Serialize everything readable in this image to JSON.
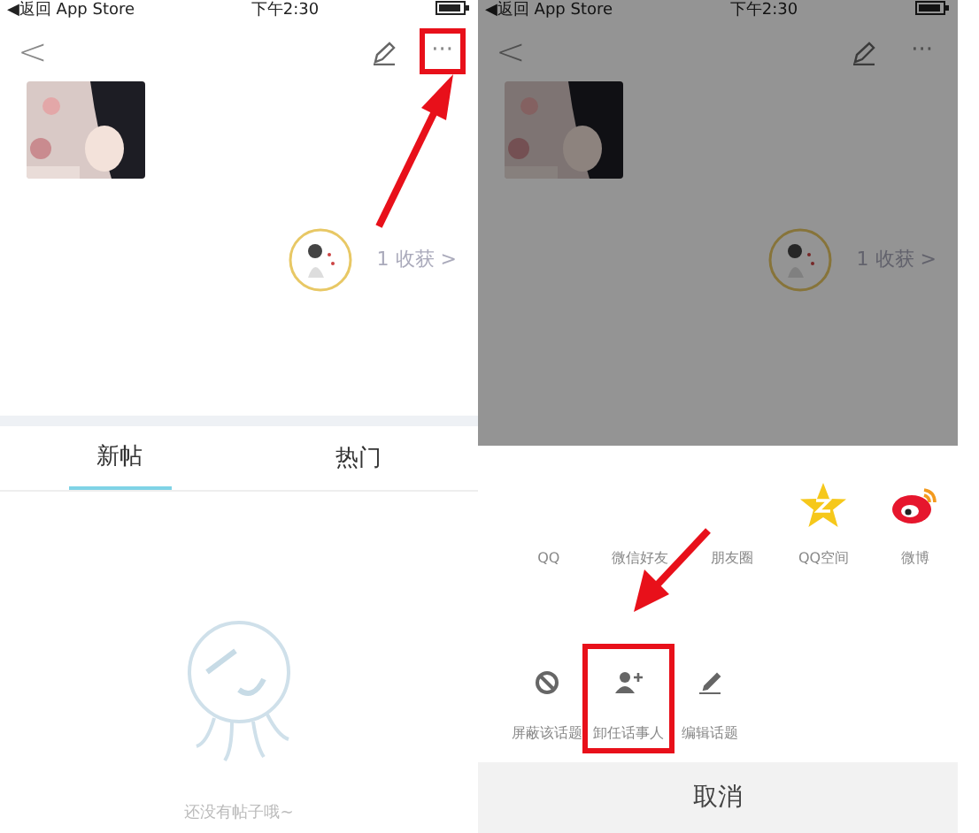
{
  "screens": [
    {
      "dimmed": false,
      "status_bar": {
        "back": "◀返回 App Store",
        "time": "下午2:30"
      },
      "nav": {
        "back": "<",
        "more": "···",
        "more_highlighted": true
      },
      "thumbnail": {
        "kind": "picture"
      },
      "harvest": "1 收获 >",
      "tabs": [
        {
          "label": "新帖",
          "selected": true
        },
        {
          "label": "热门",
          "selected": false
        }
      ],
      "empty_text": "还没有帖子哦~"
    },
    {
      "dimmed": true,
      "status_bar": {
        "back": "◀返回 App Store",
        "time": "下午2:30"
      },
      "nav": {
        "back": "<",
        "more": "···",
        "more_highlighted": false
      },
      "thumbnail": {
        "kind": "picture"
      },
      "harvest": "1 收获 >",
      "share_sheet": {
        "share_targets": [
          {
            "label": "QQ",
            "kind": "none"
          },
          {
            "label": "微信好友",
            "kind": "none"
          },
          {
            "label": "朋友圈",
            "kind": "none"
          },
          {
            "label": "QQ空间",
            "kind": "star"
          },
          {
            "label": "微博",
            "kind": "weibo"
          }
        ],
        "actions": [
          {
            "label": "屏蔽该话题",
            "kind": "block",
            "highlighted": false
          },
          {
            "label": "卸任话事人",
            "kind": "person-add",
            "highlighted": true
          },
          {
            "label": "编辑话题",
            "kind": "edit",
            "highlighted": false
          }
        ],
        "cancel": "取消"
      }
    }
  ]
}
